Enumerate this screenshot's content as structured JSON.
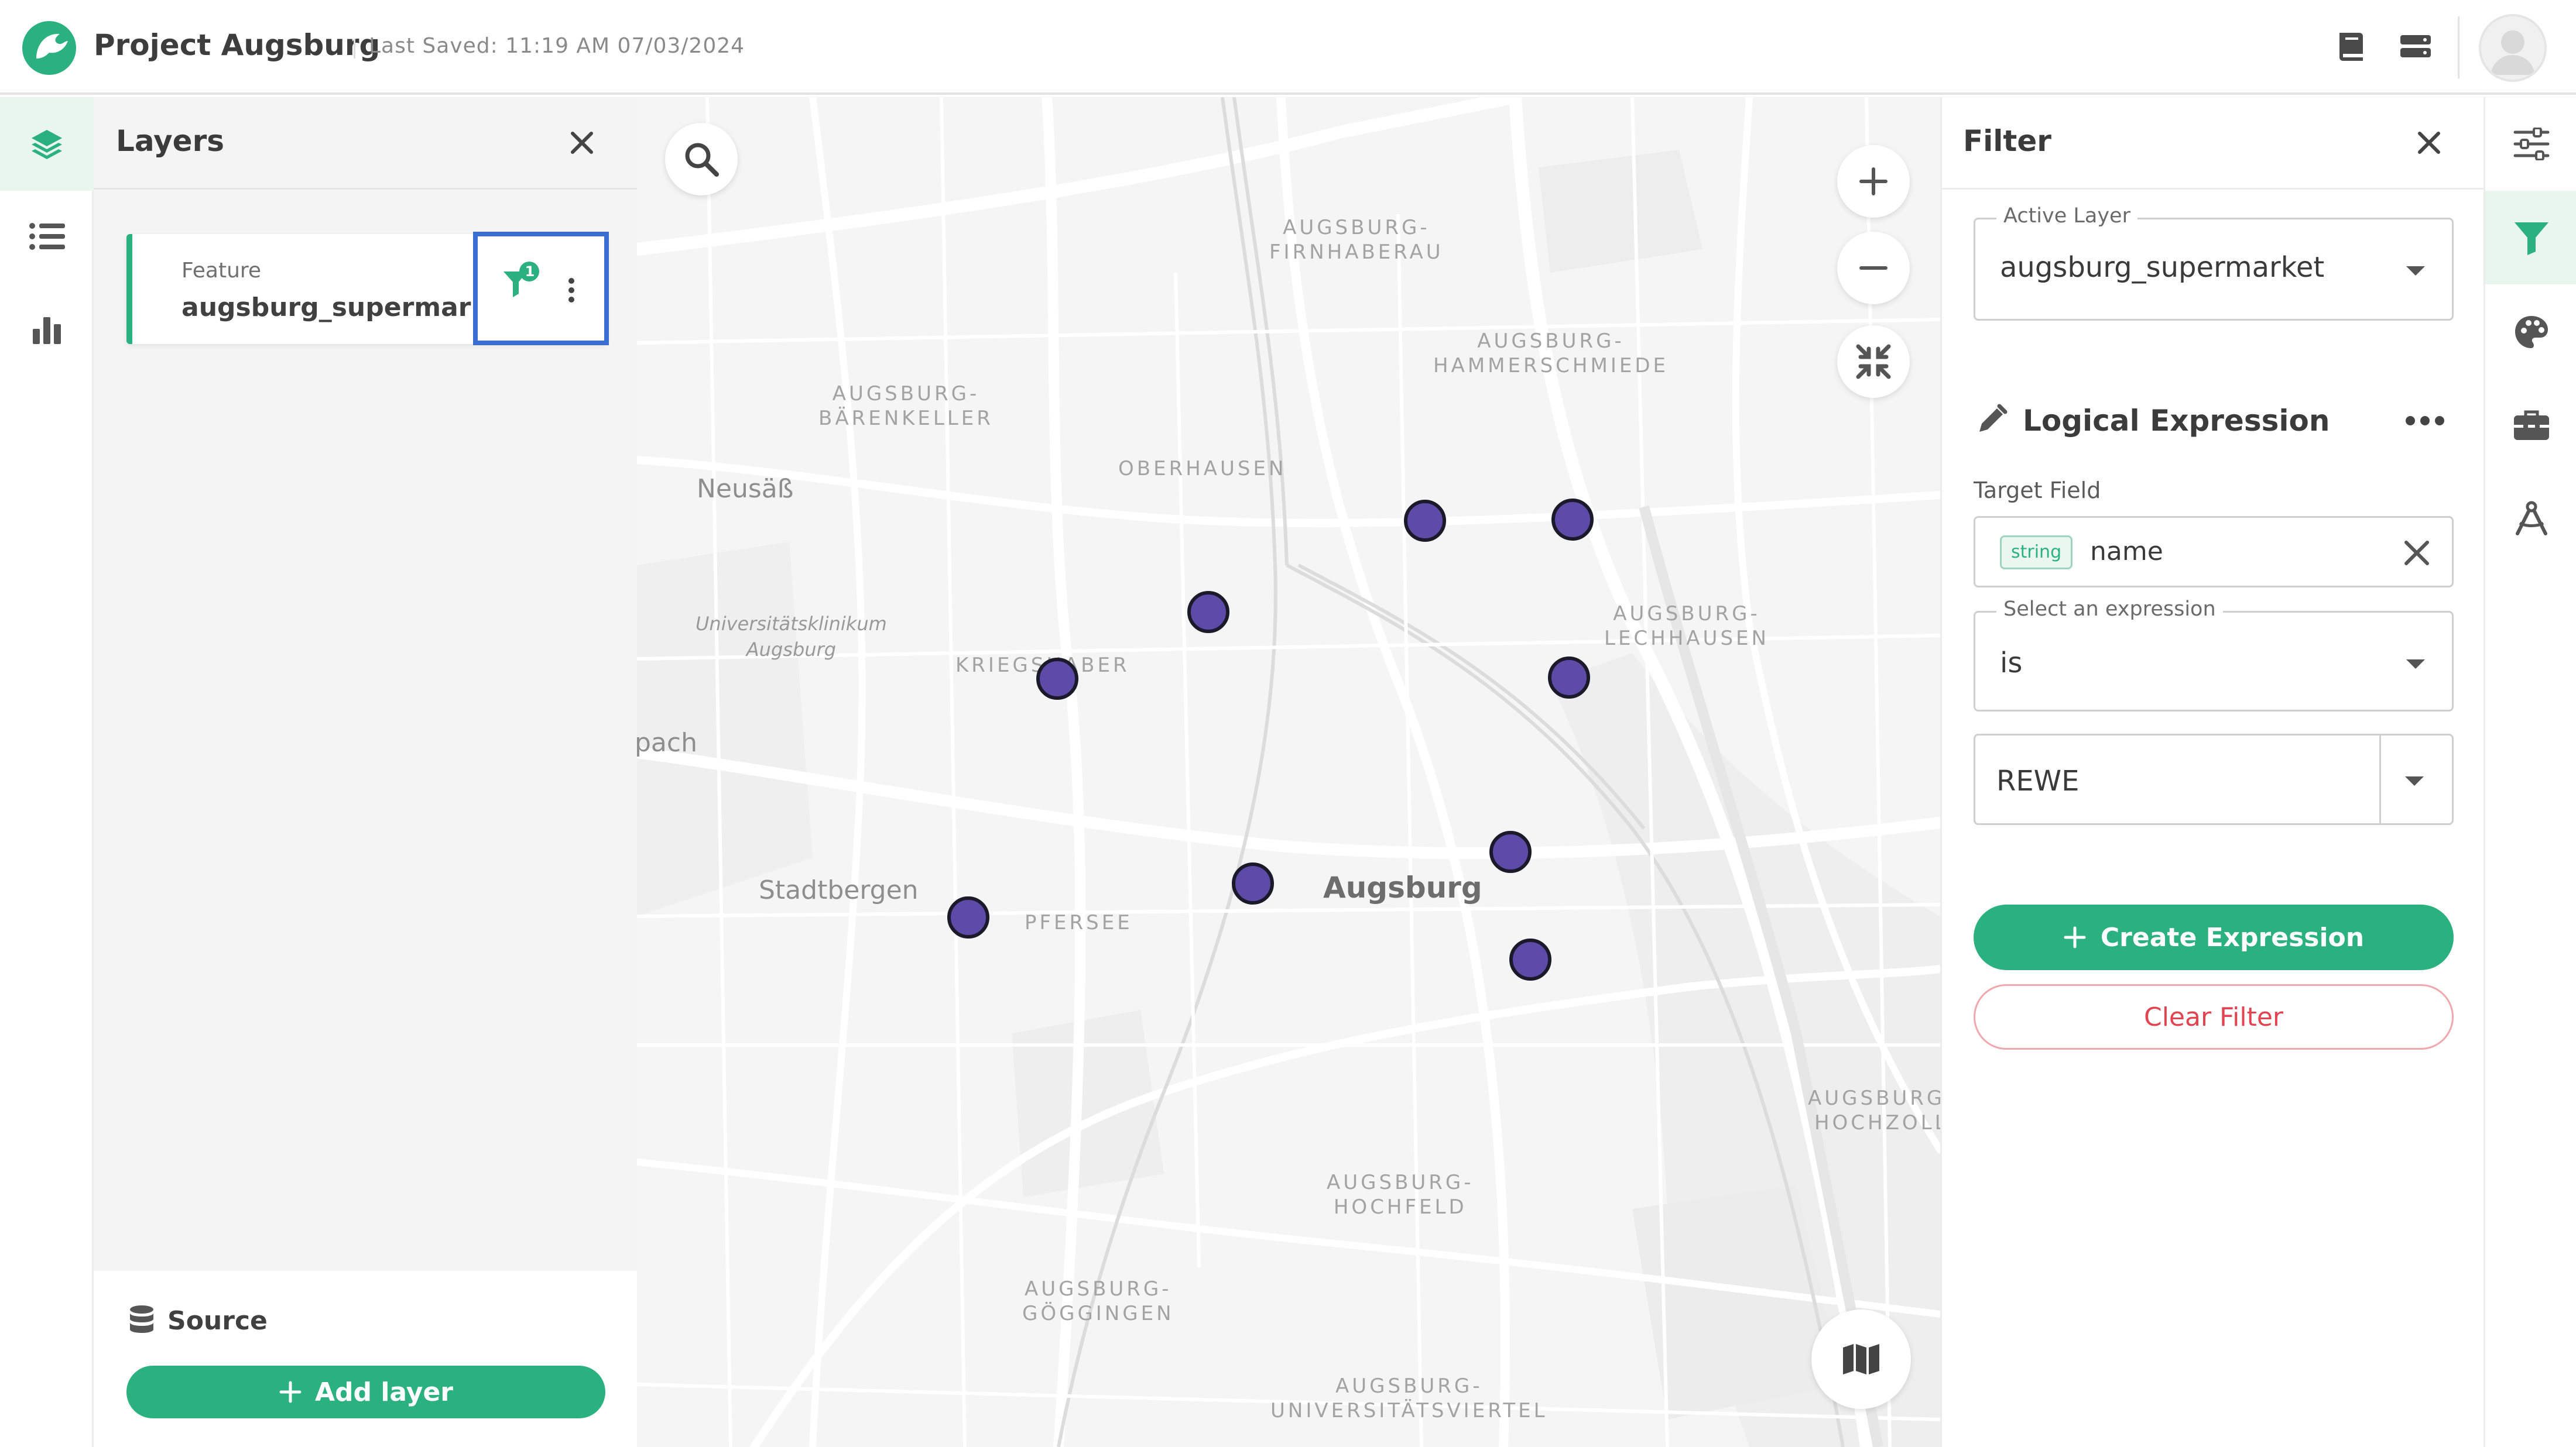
{
  "header": {
    "app_title": "Project Augsburg",
    "last_saved": "Last Saved: 11:19 AM 07/03/2024"
  },
  "layers_panel": {
    "title": "Layers",
    "layer": {
      "type": "Feature",
      "name": "augsburg_supermarket",
      "filter_count": "1"
    },
    "source_label": "Source",
    "add_layer_label": "Add layer"
  },
  "map": {
    "labels": {
      "firnhaberau": "AUGSBURG-\nFIRNHABERAU",
      "hammerschmiede": "AUGSBURG-\nHAMMERSCHMIEDE",
      "baerenkeller": "AUGSBURG-\nBÄRENKELLER",
      "oberhausen": "OBERHAUSEN",
      "neusaess": "Neusäß",
      "lechhausen": "AUGSBURG-\nLECHHAUSEN",
      "klinikum": "Universitätsklinikum\nAugsburg",
      "kriegshaber": "KRIEGSHABER",
      "stadtbergen": "Stadtbergen",
      "pfersee": "PFERSEE",
      "augsburg": "Augsburg",
      "hochzoll": "AUGSBURG-\nHOCHZOLL",
      "hochfeld": "AUGSBURG-\nHOCHFELD",
      "goeggingen": "AUGSBURG-\nGÖGGINGEN",
      "universitaetsviertel": "AUGSBURG-\nUNIVERSITÄTSVIERTEL",
      "pach": "pach"
    },
    "point_color": "#5e4ba8"
  },
  "filter_panel": {
    "title": "Filter",
    "active_layer_label": "Active Layer",
    "active_layer_value": "augsburg_supermarket",
    "expression_title": "Logical Expression",
    "target_field_label": "Target Field",
    "target_field_type": "string",
    "target_field_value": "name",
    "select_expression_label": "Select an expression",
    "select_expression_value": "is",
    "value_input": "REWE",
    "create_expression_label": "Create Expression",
    "clear_filter_label": "Clear Filter"
  },
  "colors": {
    "accent": "#2bb07f",
    "danger": "#e2434f",
    "highlight": "#3a6fd1"
  }
}
